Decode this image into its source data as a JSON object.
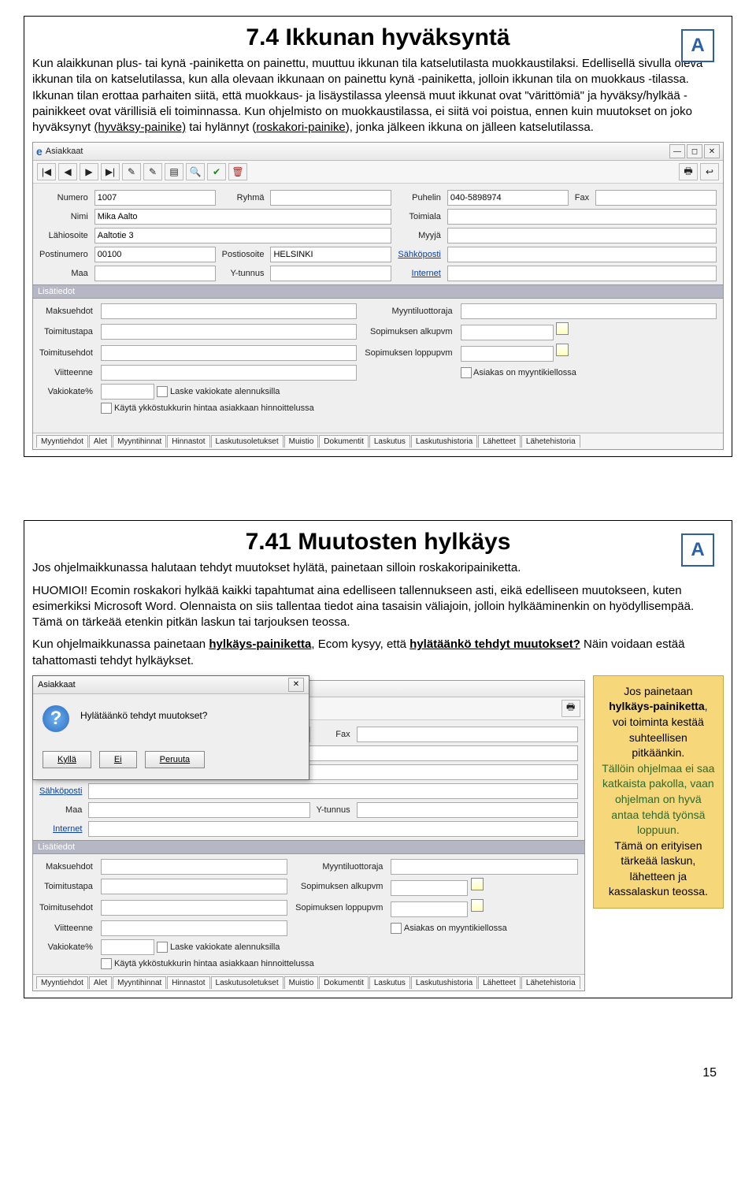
{
  "section1": {
    "title": "7.4 Ikkunan hyväksyntä",
    "body1": "Kun alaikkunan plus- tai kynä -painiketta on painettu, muuttuu ikkunan tila katselutilasta muokkaustilaksi. Edellisellä sivulla oleva ikkunan tila on katselutilassa, kun alla olevaan ikkunaan on painettu kynä -painiketta, jolloin ikkunan tila on muokkaus -tilassa. Ikkunan tilan erottaa parhaiten siitä, että muokkaus- ja lisäystilassa yleensä muut ikkunat ovat \"värittömiä\" ja hyväksy/hylkää -painikkeet ovat värillisiä eli toiminnassa. Kun ohjelmisto on muokkaustilassa, ei siitä voi poistua, ennen kuin muutokset on joko hyväksynyt ",
    "body1u1": "(hyväksy-painike)",
    "body1m": " tai hylännyt (",
    "body1u2": "roskakori-painike",
    "body1e": "), jonka jälkeen ikkuna on jälleen katselutilassa."
  },
  "form": {
    "title": "Asiakkaat",
    "labels": {
      "numero": "Numero",
      "ryhma": "Ryhmä",
      "puhelin": "Puhelin",
      "fax": "Fax",
      "nimi": "Nimi",
      "toimiala": "Toimiala",
      "lahiosoite": "Lähiosoite",
      "myyja": "Myyjä",
      "postinumero": "Postinumero",
      "postiosoite": "Postiosoite",
      "sahkoposti": "Sähköposti",
      "maa": "Maa",
      "ytunnus": "Y-tunnus",
      "internet": "Internet"
    },
    "values": {
      "numero": "1007",
      "nimi": "Mika Aalto",
      "lahiosoite": "Aaltotie 3",
      "postinumero": "00100",
      "postiosoite": "HELSINKI",
      "puhelin": "040-5898974"
    },
    "lisatiedot": "Lisätiedot",
    "labels2": {
      "maksuehdot": "Maksuehdot",
      "myyntiluottoraja": "Myyntiluottoraja",
      "toimitustapa": "Toimitustapa",
      "sopimuksen_alkupvm": "Sopimuksen alkupvm",
      "toimitusehdot": "Toimitusehdot",
      "sopimuksen_loppupvm": "Sopimuksen loppupvm",
      "viitteenne": "Viitteenne",
      "asiakas_myyntikielto": "Asiakas on myyntikiellossa",
      "vakiokate": "Vakiokate%",
      "laske_vakiokate": "Laske vakiokate alennuksilla",
      "kayta_ykkos": "Käytä ykköstukkurin hintaa asiakkaan hinnoittelussa"
    },
    "tabs": [
      "Myyntiehdot",
      "Alet",
      "Myyntihinnat",
      "Hinnastot",
      "Laskutusoletukset",
      "Muistio",
      "Dokumentit",
      "Laskutus",
      "Laskutushistoria",
      "Lähetteet",
      "Lähetehistoria"
    ]
  },
  "section2": {
    "title": "7.41 Muutosten hylkäys",
    "body1": "Jos ohjelmaikkunassa halutaan tehdyt muutokset hylätä, painetaan silloin roskakoripainiketta.",
    "body2a": "HUOMIOI! Ecomin roskakori hylkää kaikki tapahtumat aina edelliseen tallennukseen asti, eikä edelliseen muutokseen, kuten esimerkiksi Microsoft Word. Olennaista on siis tallentaa tiedot aina tasaisin väliajoin, jolloin hylkääminenkin on hyödyllisempää. Tämä on tärkeää etenkin pitkän laskun tai tarjouksen teossa.",
    "body3a": "Kun ohjelmaikkunassa painetaan ",
    "body3u1": "hylkäys-painiketta",
    "body3m": ", Ecom  kysyy, että ",
    "body3u2": "hylätäänkö tehdyt muutokset?",
    "body3e": " Näin voidaan estää tahattomasti tehdyt hylkäykset."
  },
  "dialog": {
    "title": "Asiakkaat",
    "question": "Hylätäänkö tehdyt muutokset?",
    "btn_yes": "Kyllä",
    "btn_no": "Ei",
    "btn_cancel": "Peruuta"
  },
  "sidenote": {
    "l1": "Jos painetaan ",
    "b1": "hylkäys-painiketta",
    "l2": ", voi toiminta kestää suhteellisen pitkäänkin.",
    "g1": "Tällöin ohjelmaa ei saa katkaista pakolla, vaan ohjelman on hyvä antaa tehdä työnsä loppuun.",
    "l3": " Tämä on erityisen tärkeää laskun, lähetteen ja kassalaskun teossa."
  },
  "pagenum": "15",
  "logo_letter": "A"
}
